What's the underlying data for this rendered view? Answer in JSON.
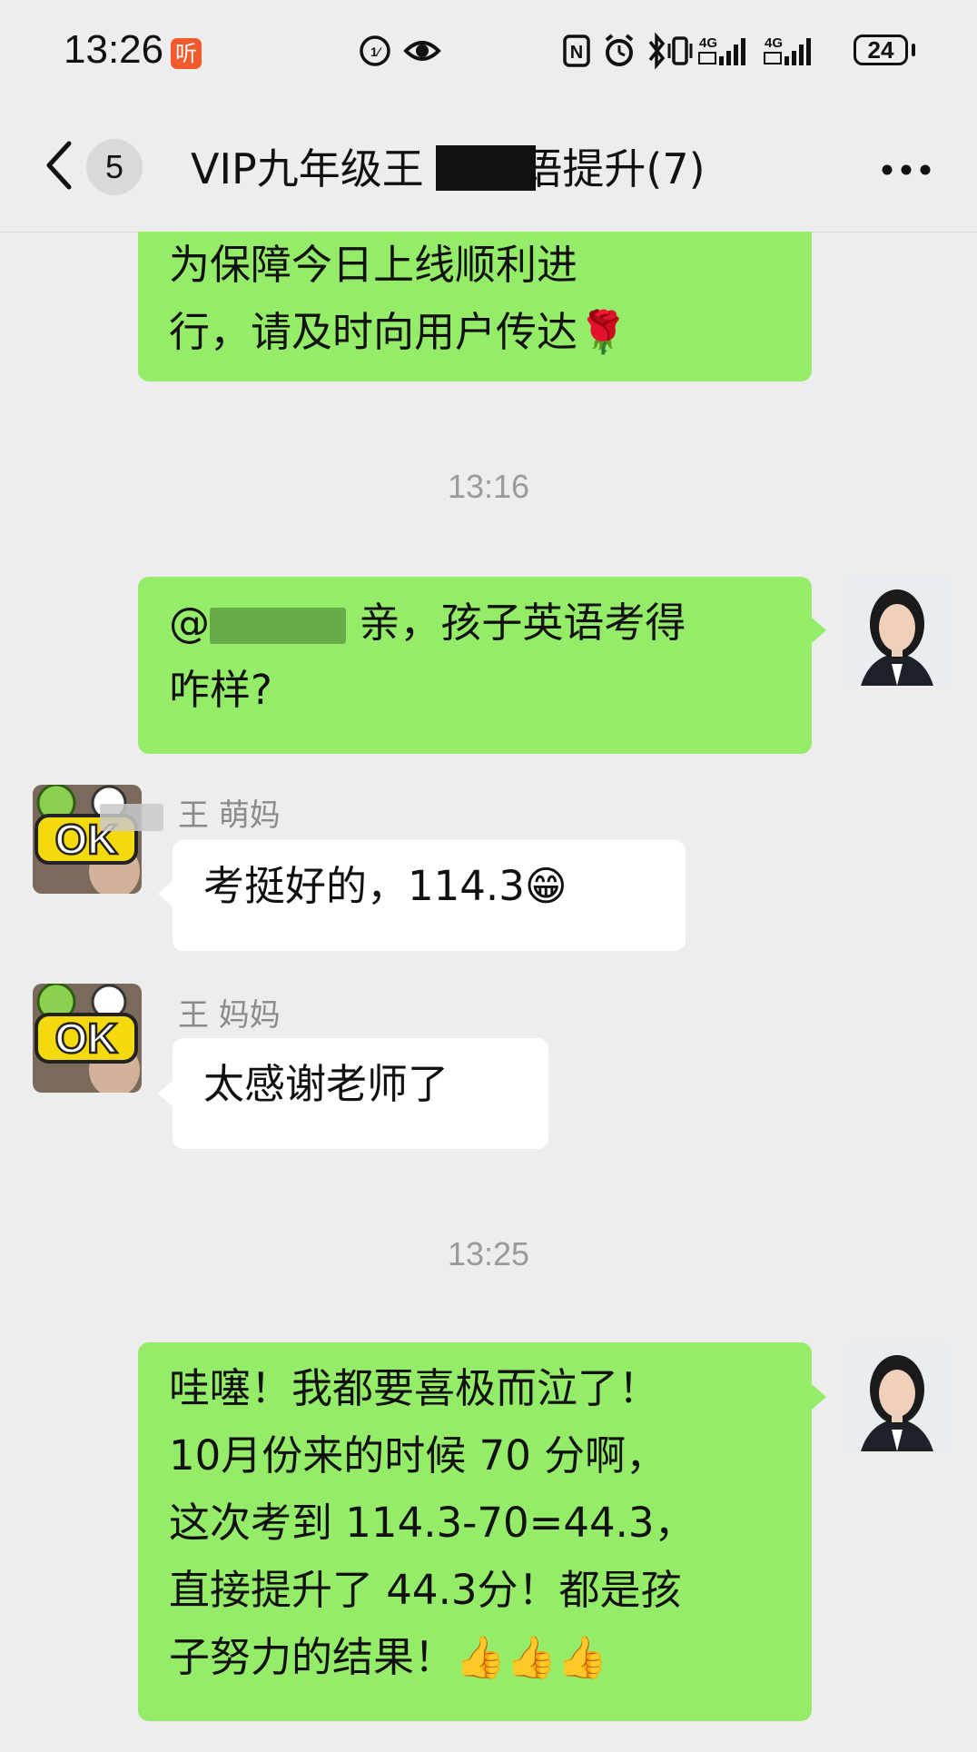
{
  "status_bar": {
    "time": "13:26",
    "listen_badge": "听",
    "battery": "24",
    "network": "4G"
  },
  "nav": {
    "unread_count": "5",
    "title": "VIP九年级王  萌英语提升(7)"
  },
  "messages": {
    "m1": {
      "lines": [
        "为保障今日上线顺利进",
        "行，请及时向用户传达🌹"
      ]
    },
    "ts1": "13:16",
    "m2": {
      "mention_prefix": "@",
      "lines_rest": "亲，孩子英语考得",
      "line2": "咋样?"
    },
    "m3": {
      "sender": "王  萌妈",
      "text": "考挺好的，114.3😁"
    },
    "m4": {
      "sender": "王  妈妈",
      "text": "太感谢老师了"
    },
    "ts2": "13:25",
    "m5": {
      "lines": [
        "哇噻！我都要喜极而泣了！",
        "10月份来的时候 70 分啊，",
        "这次考到 114.3-70=44.3，",
        "直接提升了 44.3分！都是孩",
        "子努力的结果！👍👍👍"
      ]
    }
  },
  "avatar_stickers": {
    "ok_text": "OK"
  }
}
